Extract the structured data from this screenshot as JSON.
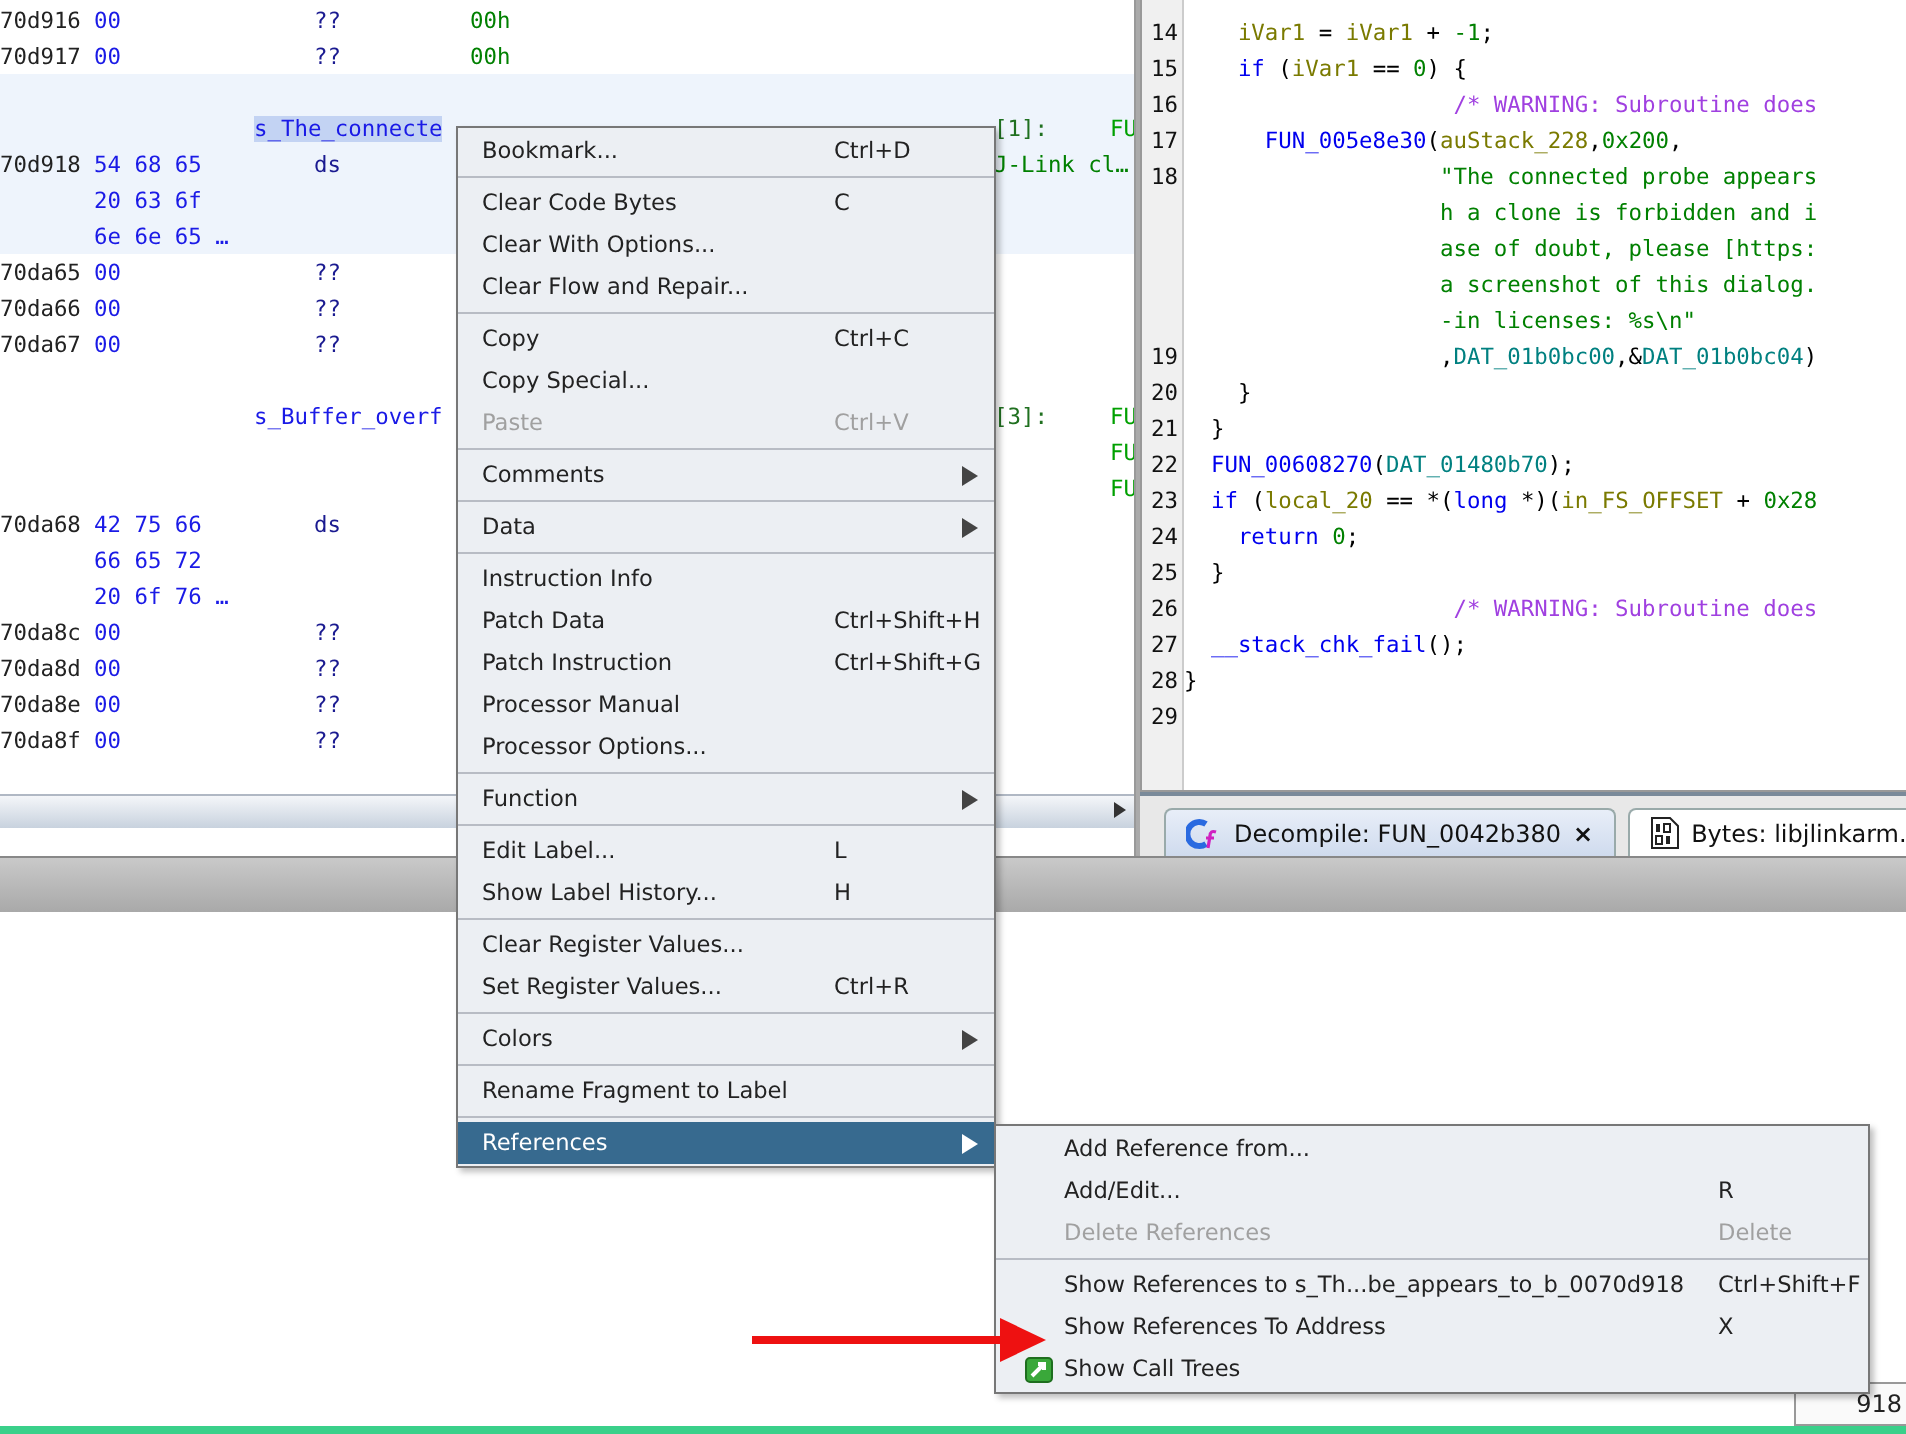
{
  "listing": {
    "rows": [
      {
        "address": "70d916",
        "bytes": "00",
        "mnemonic": "??",
        "operand": "00h",
        "highlighted": false
      },
      {
        "address": "70d917",
        "bytes": "00",
        "mnemonic": "??",
        "operand": "00h",
        "highlighted": false
      },
      {
        "highlighted": true
      },
      {
        "label": "s_The_connecte",
        "label_selected": true,
        "xref": "[1]:",
        "ref": "FU",
        "highlighted": true
      },
      {
        "address": "70d918",
        "bytes": "54 68 65",
        "mnemonic": "ds",
        "comment": "J-Link cl…",
        "highlighted": true
      },
      {
        "bytes": "20 63 6f",
        "highlighted": true
      },
      {
        "bytes": "6e 6e 65 …",
        "highlighted": true
      },
      {
        "address": "70da65",
        "bytes": "00",
        "mnemonic": "??",
        "highlighted": false
      },
      {
        "address": "70da66",
        "bytes": "00",
        "mnemonic": "??",
        "highlighted": false
      },
      {
        "address": "70da67",
        "bytes": "00",
        "mnemonic": "??",
        "highlighted": false
      },
      {
        "highlighted": false
      },
      {
        "label": "s_Buffer_overf",
        "label_selected": false,
        "xref": "[3]:",
        "ref": "FU",
        "highlighted": false
      },
      {
        "ref": "FU",
        "highlighted": false
      },
      {
        "ref": "FU",
        "highlighted": false
      },
      {
        "address": "70da68",
        "bytes": "42 75 66",
        "mnemonic": "ds",
        "highlighted": false
      },
      {
        "bytes": "66 65 72",
        "highlighted": false
      },
      {
        "bytes": "20 6f 76 …",
        "highlighted": false
      },
      {
        "address": "70da8c",
        "bytes": "00",
        "mnemonic": "??",
        "highlighted": false
      },
      {
        "address": "70da8d",
        "bytes": "00",
        "mnemonic": "??",
        "highlighted": false
      },
      {
        "address": "70da8e",
        "bytes": "00",
        "mnemonic": "??",
        "highlighted": false
      },
      {
        "address": "70da8f",
        "bytes": "00",
        "mnemonic": "??",
        "highlighted": false
      }
    ]
  },
  "decompiler": {
    "lines": [
      {
        "number": "14",
        "tokens": [
          {
            "text": "    iVar1",
            "kind": "var"
          },
          {
            "text": " = ",
            "kind": "plain"
          },
          {
            "text": "iVar1",
            "kind": "var"
          },
          {
            "text": " + ",
            "kind": "plain"
          },
          {
            "text": "-1",
            "kind": "num"
          },
          {
            "text": ";",
            "kind": "plain"
          }
        ]
      },
      {
        "number": "15",
        "tokens": [
          {
            "text": "    if",
            "kind": "keyword"
          },
          {
            "text": " (",
            "kind": "plain"
          },
          {
            "text": "iVar1",
            "kind": "var"
          },
          {
            "text": " == ",
            "kind": "plain"
          },
          {
            "text": "0",
            "kind": "num"
          },
          {
            "text": ") {",
            "kind": "plain"
          }
        ]
      },
      {
        "number": "16",
        "tokens": [
          {
            "text": "                    /* WARNING: Subroutine does",
            "kind": "comment"
          }
        ]
      },
      {
        "number": "17",
        "tokens": [
          {
            "text": "      FUN_005e8e30",
            "kind": "func"
          },
          {
            "text": "(",
            "kind": "plain"
          },
          {
            "text": "auStack_228",
            "kind": "var"
          },
          {
            "text": ",",
            "kind": "plain"
          },
          {
            "text": "0x200",
            "kind": "num"
          },
          {
            "text": ",",
            "kind": "plain"
          }
        ]
      },
      {
        "number": "18",
        "tokens": [
          {
            "text": "                   \"The connected probe appears",
            "kind": "string"
          }
        ]
      },
      {
        "tokens": [
          {
            "text": "                   h a clone is forbidden and i",
            "kind": "string"
          }
        ]
      },
      {
        "tokens": [
          {
            "text": "                   ase of doubt, please [https:",
            "kind": "string"
          }
        ]
      },
      {
        "tokens": [
          {
            "text": "                   a screenshot of this dialog.",
            "kind": "string"
          }
        ]
      },
      {
        "tokens": [
          {
            "text": "                   -in licenses: %s\\n\"",
            "kind": "string"
          }
        ]
      },
      {
        "number": "19",
        "tokens": [
          {
            "text": "                   ,",
            "kind": "plain"
          },
          {
            "text": "DAT_01b0bc00",
            "kind": "global"
          },
          {
            "text": ",&",
            "kind": "plain"
          },
          {
            "text": "DAT_01b0bc04",
            "kind": "global"
          },
          {
            "text": ")",
            "kind": "plain"
          }
        ]
      },
      {
        "number": "20",
        "tokens": [
          {
            "text": "    }",
            "kind": "plain"
          }
        ]
      },
      {
        "number": "21",
        "tokens": [
          {
            "text": "  }",
            "kind": "plain"
          }
        ]
      },
      {
        "number": "22",
        "tokens": [
          {
            "text": "  FUN_00608270",
            "kind": "func"
          },
          {
            "text": "(",
            "kind": "plain"
          },
          {
            "text": "DAT_01480b70",
            "kind": "global"
          },
          {
            "text": ");",
            "kind": "plain"
          }
        ]
      },
      {
        "number": "23",
        "tokens": [
          {
            "text": "  if",
            "kind": "keyword"
          },
          {
            "text": " (",
            "kind": "plain"
          },
          {
            "text": "local_20",
            "kind": "var"
          },
          {
            "text": " == *(",
            "kind": "plain"
          },
          {
            "text": "long",
            "kind": "keyword"
          },
          {
            "text": " *)(",
            "kind": "plain"
          },
          {
            "text": "in_FS_OFFSET",
            "kind": "var"
          },
          {
            "text": " + ",
            "kind": "plain"
          },
          {
            "text": "0x28",
            "kind": "num"
          }
        ]
      },
      {
        "number": "24",
        "tokens": [
          {
            "text": "    return",
            "kind": "keyword"
          },
          {
            "text": " 0",
            "kind": "num"
          },
          {
            "text": ";",
            "kind": "plain"
          }
        ]
      },
      {
        "number": "25",
        "tokens": [
          {
            "text": "  }",
            "kind": "plain"
          }
        ]
      },
      {
        "number": "26",
        "tokens": [
          {
            "text": "                    /* WARNING: Subroutine does",
            "kind": "comment"
          }
        ]
      },
      {
        "number": "27",
        "tokens": [
          {
            "text": "  __stack_chk_fail",
            "kind": "func"
          },
          {
            "text": "();",
            "kind": "plain"
          }
        ]
      },
      {
        "number": "28",
        "tokens": [
          {
            "text": "}",
            "kind": "plain"
          }
        ]
      },
      {
        "number": "29"
      }
    ]
  },
  "tabs": [
    {
      "label": "Decompile: FUN_0042b380",
      "close": "×",
      "kind": "decompile",
      "selected": true
    },
    {
      "label": "Bytes: libjlinkarm.",
      "kind": "bytes",
      "selected": false
    }
  ],
  "context_menu": {
    "groups": [
      [
        {
          "label": "Bookmark...",
          "shortcut": "Ctrl+D",
          "submenu": false,
          "disabled": false,
          "selected": false
        }
      ],
      [
        {
          "label": "Clear Code Bytes",
          "shortcut": "C",
          "submenu": false,
          "disabled": false,
          "selected": false
        },
        {
          "label": "Clear With Options...",
          "submenu": false,
          "disabled": false,
          "selected": false
        },
        {
          "label": "Clear Flow and Repair...",
          "submenu": false,
          "disabled": false,
          "selected": false
        }
      ],
      [
        {
          "label": "Copy",
          "shortcut": "Ctrl+C",
          "submenu": false,
          "disabled": false,
          "selected": false
        },
        {
          "label": "Copy Special...",
          "submenu": false,
          "disabled": false,
          "selected": false
        },
        {
          "label": "Paste",
          "shortcut": "Ctrl+V",
          "submenu": false,
          "disabled": true,
          "selected": false
        }
      ],
      [
        {
          "label": "Comments",
          "submenu": true,
          "disabled": false,
          "selected": false
        }
      ],
      [
        {
          "label": "Data",
          "submenu": true,
          "disabled": false,
          "selected": false
        }
      ],
      [
        {
          "label": "Instruction Info",
          "submenu": false,
          "disabled": false,
          "selected": false
        },
        {
          "label": "Patch Data",
          "shortcut": "Ctrl+Shift+H",
          "submenu": false,
          "disabled": false,
          "selected": false
        },
        {
          "label": "Patch Instruction",
          "shortcut": "Ctrl+Shift+G",
          "submenu": false,
          "disabled": false,
          "selected": false
        },
        {
          "label": "Processor Manual",
          "submenu": false,
          "disabled": false,
          "selected": false
        },
        {
          "label": "Processor Options...",
          "submenu": false,
          "disabled": false,
          "selected": false
        }
      ],
      [
        {
          "label": "Function",
          "submenu": true,
          "disabled": false,
          "selected": false
        }
      ],
      [
        {
          "label": "Edit Label...",
          "shortcut": "L",
          "submenu": false,
          "disabled": false,
          "selected": false
        },
        {
          "label": "Show Label History...",
          "shortcut": "H",
          "submenu": false,
          "disabled": false,
          "selected": false
        }
      ],
      [
        {
          "label": "Clear Register Values...",
          "submenu": false,
          "disabled": false,
          "selected": false
        },
        {
          "label": "Set Register Values...",
          "shortcut": "Ctrl+R",
          "submenu": false,
          "disabled": false,
          "selected": false
        }
      ],
      [
        {
          "label": "Colors",
          "submenu": true,
          "disabled": false,
          "selected": false
        }
      ],
      [
        {
          "label": "Rename Fragment to Label",
          "submenu": false,
          "disabled": false,
          "selected": false
        }
      ],
      [
        {
          "label": "References",
          "submenu": true,
          "disabled": false,
          "selected": true
        }
      ]
    ]
  },
  "submenu": {
    "groups": [
      [
        {
          "label": "Add Reference from...",
          "kind": "plain",
          "disabled": false,
          "selected": false
        },
        {
          "label": "Add/Edit...",
          "shortcut": "R",
          "kind": "plain",
          "disabled": false,
          "selected": false
        },
        {
          "label": "Delete References",
          "shortcut": "Delete",
          "kind": "plain",
          "disabled": true,
          "selected": false
        }
      ],
      [
        {
          "label": "Show References to s_Th...be_appears_to_b_0070d918",
          "shortcut": "Ctrl+Shift+F",
          "kind": "plain",
          "disabled": false,
          "selected": false
        },
        {
          "label": "Show References To Address",
          "shortcut": "X",
          "kind": "plain",
          "disabled": false,
          "selected": false
        },
        {
          "label": "Show Call Trees",
          "kind": "call-tree",
          "disabled": false,
          "selected": false
        }
      ]
    ]
  },
  "status_bar": {
    "address": "918"
  }
}
